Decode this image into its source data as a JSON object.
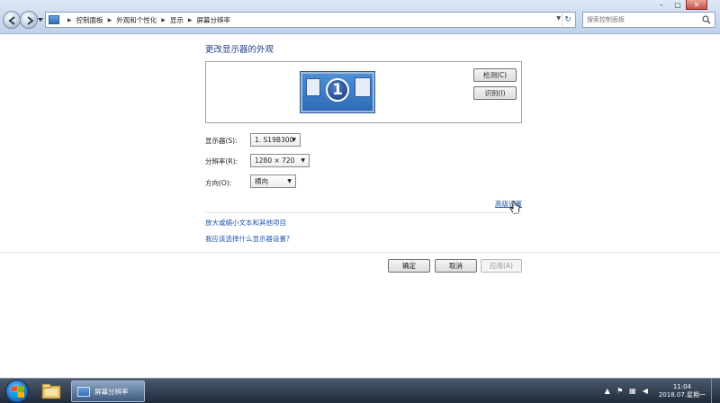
{
  "address_bar": {
    "crumbs": [
      "控制面板",
      "外观和个性化",
      "显示",
      "屏幕分辨率"
    ]
  },
  "search": {
    "placeholder": "搜索控制面板"
  },
  "main": {
    "title": "更改显示器的外观",
    "detect_label": "检测(C)",
    "identify_label": "识别(I)",
    "monitor_number": "1",
    "display_label": "显示器(S):",
    "display_value": "1. S19B300",
    "resolution_label": "分辨率(R):",
    "resolution_value": "1280 × 720",
    "orientation_label": "方向(O):",
    "orientation_value": "横向",
    "advanced_link": "高级设置",
    "link_text_size": "放大或缩小文本和其他项目",
    "link_which_settings": "我应该选择什么显示器设置?"
  },
  "buttons": {
    "ok": "确定",
    "cancel": "取消",
    "apply": "应用(A)"
  },
  "taskbar": {
    "active_task": "屏幕分辨率",
    "time": "11:04",
    "date": "2018.07.星期一"
  },
  "colors": {
    "link": "#1e56b0",
    "title": "#1e3f8a",
    "taskbar": "#1f2a38"
  }
}
